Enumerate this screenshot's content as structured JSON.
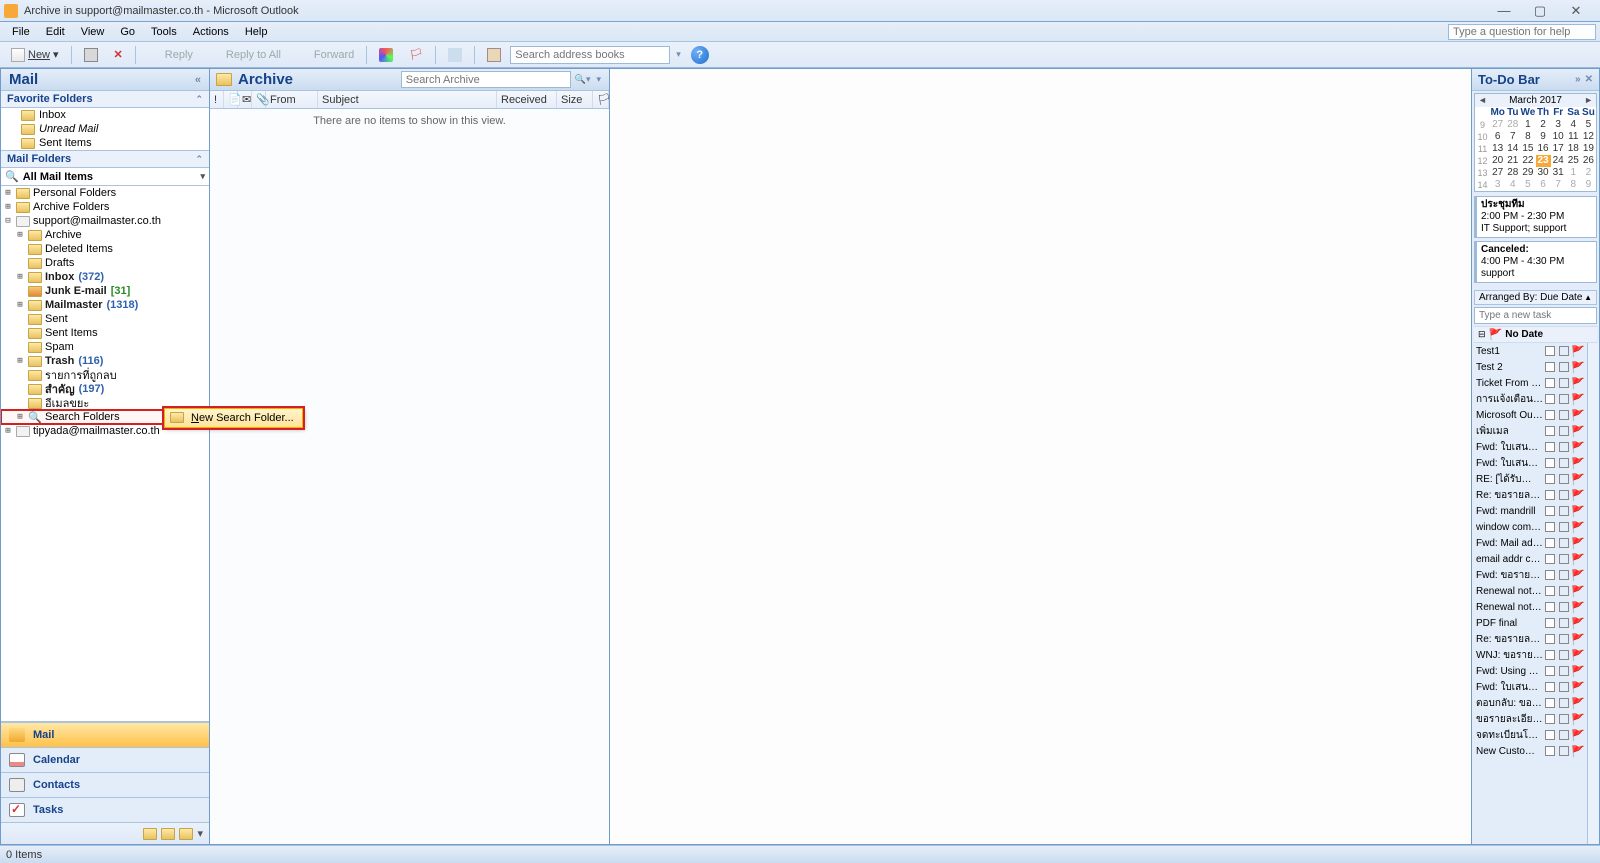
{
  "window": {
    "title": "Archive in support@mailmaster.co.th - Microsoft Outlook"
  },
  "menu": [
    "File",
    "Edit",
    "View",
    "Go",
    "Tools",
    "Actions",
    "Help"
  ],
  "help_box": {
    "placeholder": "Type a question for help"
  },
  "toolbar": {
    "new": "New",
    "print": "",
    "reply": "Reply",
    "reply_all": "Reply to All",
    "forward": "Forward",
    "search_ab_ph": "Search address books"
  },
  "nav": {
    "header": "Mail",
    "fav_section": "Favorite Folders",
    "fav": [
      "Inbox",
      "Unread Mail",
      "Sent Items"
    ],
    "mail_section": "Mail Folders",
    "all_items": "All Mail Items",
    "tree": [
      {
        "lvl": 0,
        "exp": "+",
        "ico": "f",
        "label": "Personal Folders"
      },
      {
        "lvl": 0,
        "exp": "+",
        "ico": "f",
        "label": "Archive Folders"
      },
      {
        "lvl": 0,
        "exp": "-",
        "ico": "m",
        "label": "support@mailmaster.co.th"
      },
      {
        "lvl": 1,
        "exp": "+",
        "ico": "f",
        "label": "Archive"
      },
      {
        "lvl": 1,
        "exp": "",
        "ico": "f",
        "label": "Deleted Items"
      },
      {
        "lvl": 1,
        "exp": "",
        "ico": "f",
        "label": "Drafts"
      },
      {
        "lvl": 1,
        "exp": "+",
        "ico": "f",
        "label": "Inbox",
        "count": "(372)",
        "bold": true
      },
      {
        "lvl": 1,
        "exp": "",
        "ico": "j",
        "label": "Junk E-mail",
        "count": "[31]",
        "bold": true,
        "green": true
      },
      {
        "lvl": 1,
        "exp": "+",
        "ico": "f",
        "label": "Mailmaster",
        "count": "(1318)",
        "bold": true
      },
      {
        "lvl": 1,
        "exp": "",
        "ico": "f",
        "label": "Sent"
      },
      {
        "lvl": 1,
        "exp": "",
        "ico": "f",
        "label": "Sent Items"
      },
      {
        "lvl": 1,
        "exp": "",
        "ico": "f",
        "label": "Spam"
      },
      {
        "lvl": 1,
        "exp": "+",
        "ico": "f",
        "label": "Trash",
        "count": "(116)",
        "bold": true
      },
      {
        "lvl": 1,
        "exp": "",
        "ico": "f",
        "label": "รายการที่ถูกลบ"
      },
      {
        "lvl": 1,
        "exp": "",
        "ico": "f",
        "label": "สำคัญ",
        "count": "(197)",
        "bold": true
      },
      {
        "lvl": 1,
        "exp": "",
        "ico": "f",
        "label": "อีเมลขยะ"
      },
      {
        "lvl": 1,
        "exp": "+",
        "ico": "s",
        "label": "Search Folders",
        "hl": true
      },
      {
        "lvl": 0,
        "exp": "+",
        "ico": "m",
        "label": "tipyada@mailmaster.co.th"
      }
    ],
    "buttons": [
      {
        "label": "Mail",
        "ico": "mail",
        "sel": true
      },
      {
        "label": "Calendar",
        "ico": "cal"
      },
      {
        "label": "Contacts",
        "ico": "con"
      },
      {
        "label": "Tasks",
        "ico": "tsk"
      }
    ]
  },
  "ctx": {
    "item": "New Search Folder...",
    "underline": "N"
  },
  "list": {
    "title": "Archive",
    "search_ph": "Search Archive",
    "cols": [
      "!",
      "📎",
      "",
      "From",
      "Subject",
      "Received",
      "Size",
      "🏳"
    ],
    "empty": "There are no items to show in this view."
  },
  "todo": {
    "header": "To-Do Bar",
    "cal_title": "March 2017",
    "dow": [
      "Mo",
      "Tu",
      "We",
      "Th",
      "Fr",
      "Sa",
      "Su"
    ],
    "wk": [
      "9",
      "10",
      "11",
      "12",
      "13",
      "14"
    ],
    "grid": [
      [
        27,
        28,
        1,
        2,
        3,
        4,
        5
      ],
      [
        6,
        7,
        8,
        9,
        10,
        11,
        12
      ],
      [
        13,
        14,
        15,
        16,
        17,
        18,
        19
      ],
      [
        20,
        21,
        22,
        23,
        24,
        25,
        26
      ],
      [
        27,
        28,
        29,
        30,
        31,
        1,
        2
      ],
      [
        3,
        4,
        5,
        6,
        7,
        8,
        9
      ]
    ],
    "today": 23,
    "appts": [
      {
        "t": "ประชุมทีม",
        "d": "2:00 PM - 2:30 PM",
        "w": "IT Support; support"
      },
      {
        "t": "Canceled:",
        "d": "4:00 PM - 4:30 PM",
        "w": "support"
      }
    ],
    "arranged": "Arranged By: Due Date",
    "task_ph": "Type a new task",
    "group": "No Date",
    "tasks": [
      "Test1",
      "Test 2",
      "Ticket From Back...",
      "การแจ้งเตือนเกี่ยวก...",
      "Microsoft Outlo...",
      "เพิ่มเมล",
      "Fwd: ใบเสนอราค...",
      "Fwd: ใบเสนอราค...",
      "RE: [ได้รับคำร้องข...",
      "Re: ขอรายละเอียด...",
      "Fwd: mandrill",
      "window comma...",
      "Fwd: Mail admin",
      "email addr check",
      "Fwd: ขอรายละเอี...",
      "Renewal notifica...",
      "Renewal notifica...",
      "PDF final",
      "Re: ขอรายละเอียด...",
      "WNJ: ขอรายละเอี...",
      "Fwd: Using Tips ...",
      "Fwd: ใบเสนอราคา",
      "ตอบกลับ: ขอรายล...",
      "ขอรายละเอียดสำห...",
      "จดทะเบียนโดเมน...",
      "New Customer : ..."
    ]
  },
  "status": "0 Items"
}
